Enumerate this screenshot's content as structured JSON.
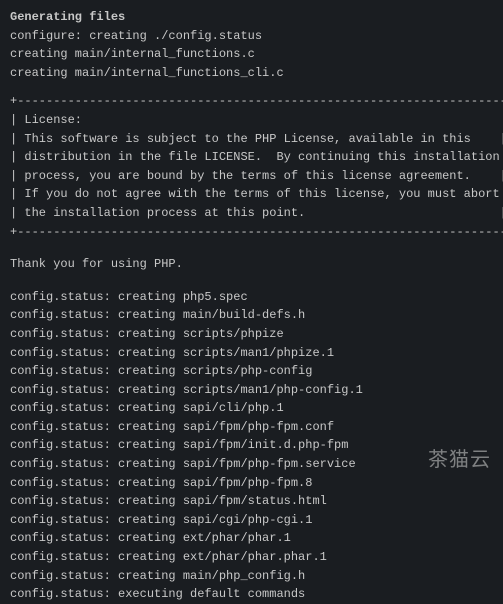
{
  "heading": "Generating files",
  "intro_lines": [
    "configure: creating ./config.status",
    "creating main/internal_functions.c",
    "creating main/internal_functions_cli.c"
  ],
  "license_box": {
    "border_top": "+--------------------------------------------------------------------+",
    "lines": [
      "| License:                                                           |",
      "| This software is subject to the PHP License, available in this    |",
      "| distribution in the file LICENSE.  By continuing this installation |",
      "| process, you are bound by the terms of this license agreement.    |",
      "| If you do not agree with the terms of this license, you must abort |",
      "| the installation process at this point.                           |"
    ],
    "border_bottom": "+--------------------------------------------------------------------+"
  },
  "thankyou": "Thank you for using PHP.",
  "status_lines": [
    "config.status: creating php5.spec",
    "config.status: creating main/build-defs.h",
    "config.status: creating scripts/phpize",
    "config.status: creating scripts/man1/phpize.1",
    "config.status: creating scripts/php-config",
    "config.status: creating scripts/man1/php-config.1",
    "config.status: creating sapi/cli/php.1",
    "config.status: creating sapi/fpm/php-fpm.conf",
    "config.status: creating sapi/fpm/init.d.php-fpm",
    "config.status: creating sapi/fpm/php-fpm.service",
    "config.status: creating sapi/fpm/php-fpm.8",
    "config.status: creating sapi/fpm/status.html",
    "config.status: creating sapi/cgi/php-cgi.1",
    "config.status: creating ext/phar/phar.1",
    "config.status: creating ext/phar/phar.phar.1",
    "config.status: creating main/php_config.h",
    "config.status: executing default commands"
  ],
  "watermark": "茶猫云"
}
